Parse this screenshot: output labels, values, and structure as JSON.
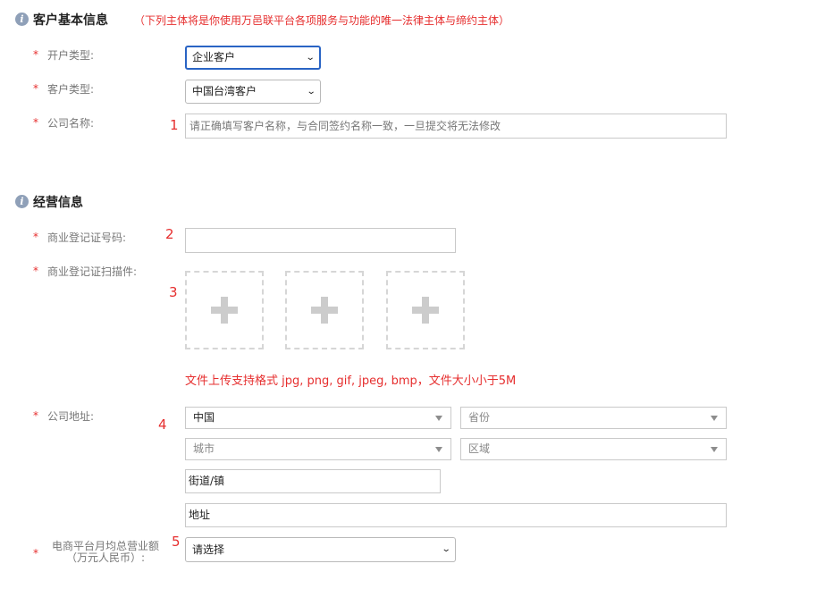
{
  "section_customer": {
    "title": "客户基本信息",
    "note": "（下列主体将是你使用万邑联平台各项服务与功能的唯一法律主体与缔约主体）",
    "account_type": {
      "label": "开户类型:",
      "value": "企业客户"
    },
    "customer_type": {
      "label": "客户类型:",
      "value": "中国台湾客户"
    },
    "company_name": {
      "label": "公司名称:",
      "placeholder": "请正确填写客户名称，与合同签约名称一致，一旦提交将无法修改"
    }
  },
  "section_business": {
    "title": "经营信息",
    "reg_number": {
      "label": "商业登记证号码:",
      "value": ""
    },
    "reg_scan": {
      "label": "商业登记证扫描件:",
      "upload_note": "文件上传支持格式 jpg, png, gif, jpeg, bmp，文件大小小于5M"
    },
    "address": {
      "label": "公司地址:",
      "country": "中国",
      "province": "省份",
      "city": "城市",
      "district": "区域",
      "street": "街道/镇",
      "detail": "地址"
    },
    "revenue": {
      "label_line1": "电商平台月均总营业额",
      "label_line2": "（万元人民币）:",
      "value": "请选择"
    }
  },
  "required_mark": "*",
  "markers": [
    "1",
    "2",
    "3",
    "4",
    "5"
  ],
  "colors": {
    "required": "#e62e2e",
    "focus_border": "#2a64c4",
    "section_icon": "#8fa0b8"
  }
}
